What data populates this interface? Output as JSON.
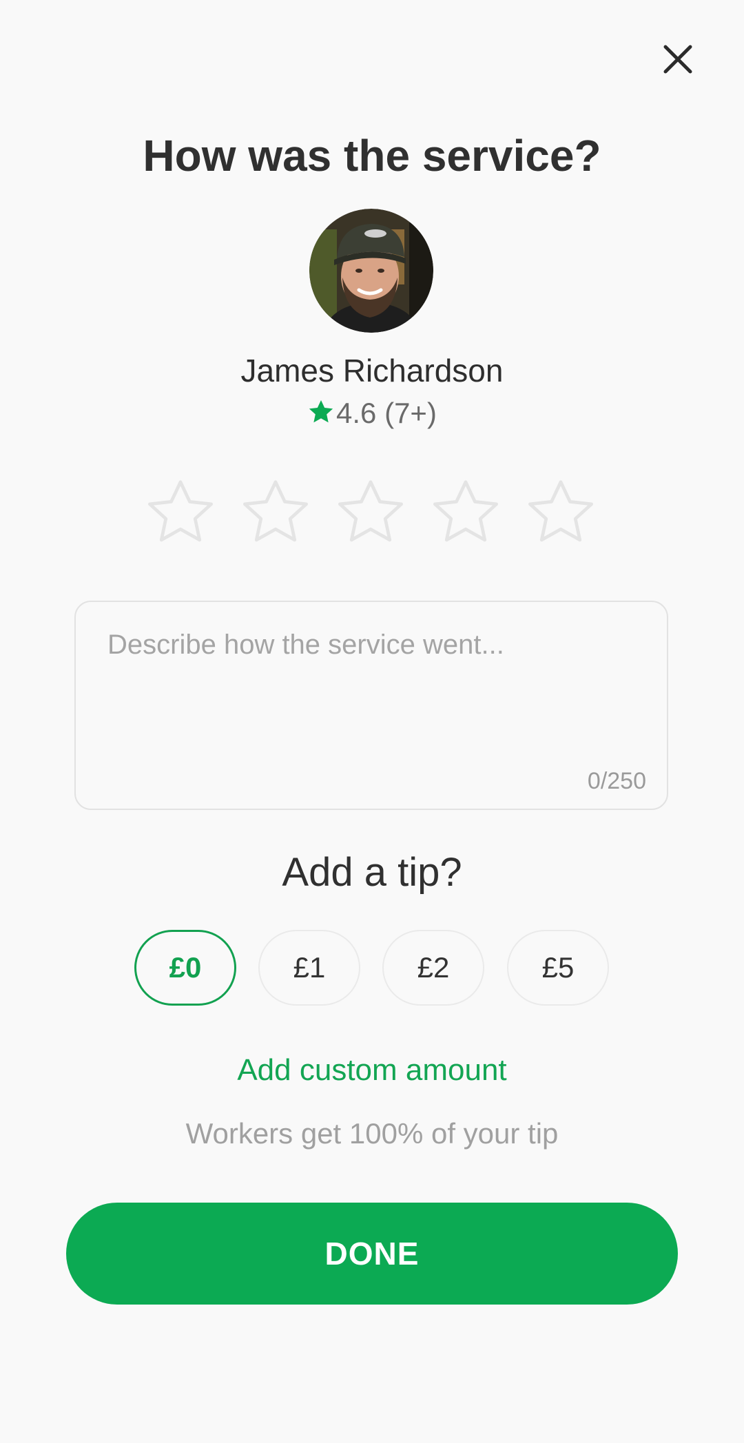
{
  "header": {
    "title": "How was the service?"
  },
  "worker": {
    "name": "James Richardson",
    "rating": "4.6 (7+)",
    "avatar_icon": "person-photo"
  },
  "rating_input": {
    "max_stars": 5,
    "selected": 0
  },
  "feedback": {
    "placeholder": "Describe how the service went...",
    "value": "",
    "counter": "0/250"
  },
  "tip": {
    "title": "Add a tip?",
    "options": [
      "£0",
      "£1",
      "£2",
      "£5"
    ],
    "selected": "£0",
    "custom_label": "Add custom amount",
    "note": "Workers get 100% of your tip"
  },
  "actions": {
    "done_label": "DONE"
  },
  "colors": {
    "accent": "#0caa53",
    "star_outline": "#e4e4e4",
    "background": "#f9f9f9"
  }
}
